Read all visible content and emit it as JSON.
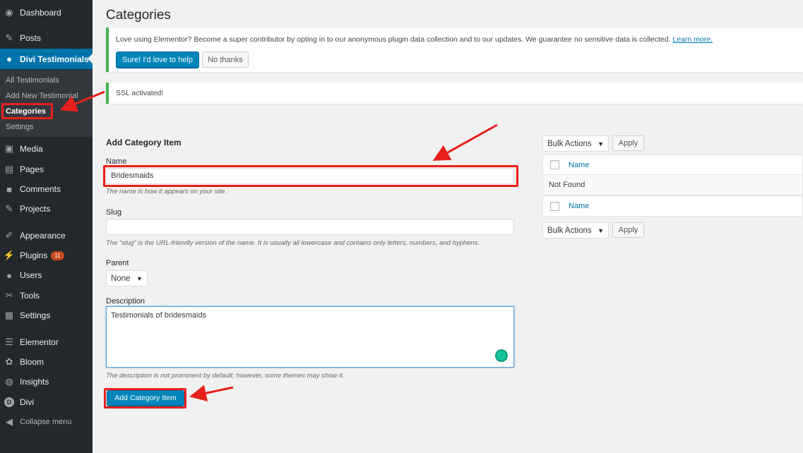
{
  "sidebar": {
    "items": [
      {
        "label": "Dashboard",
        "icon": "dashboard-icon"
      },
      {
        "label": "Posts",
        "icon": "pin-icon"
      },
      {
        "label": "Divi Testimonials",
        "icon": "user-icon"
      },
      {
        "label": "Media",
        "icon": "media-icon"
      },
      {
        "label": "Pages",
        "icon": "pages-icon"
      },
      {
        "label": "Comments",
        "icon": "comment-icon"
      },
      {
        "label": "Projects",
        "icon": "pin-icon"
      },
      {
        "label": "Appearance",
        "icon": "brush-icon"
      },
      {
        "label": "Plugins",
        "icon": "plug-icon",
        "badge": "11"
      },
      {
        "label": "Users",
        "icon": "user-icon"
      },
      {
        "label": "Tools",
        "icon": "wrench-icon"
      },
      {
        "label": "Settings",
        "icon": "settings-icon"
      },
      {
        "label": "Elementor",
        "icon": "elementor-icon"
      },
      {
        "label": "Bloom",
        "icon": "bloom-icon"
      },
      {
        "label": "Insights",
        "icon": "insights-icon"
      },
      {
        "label": "Divi",
        "icon": "divi-icon"
      },
      {
        "label": "Collapse menu",
        "icon": "collapse-icon"
      }
    ],
    "submenu": [
      "All Testimonials",
      "Add New Testimonial",
      "Categories",
      "Settings"
    ]
  },
  "page": {
    "title": "Categories"
  },
  "notices": {
    "elementor": {
      "text": "Love using Elementor? Become a super contributor by opting in to our anonymous plugin data collection and to our updates. We guarantee no sensitive data is collected.",
      "link": "Learn more.",
      "accept": "Sure! I'd love to help",
      "decline": "No thanks"
    },
    "ssl": "SSL activated!"
  },
  "form": {
    "heading": "Add Category Item",
    "name_label": "Name",
    "name_value": "Bridesmaids",
    "name_hint": "The name is how it appears on your site.",
    "slug_label": "Slug",
    "slug_value": "",
    "slug_hint": "The “slug” is the URL-friendly version of the name. It is usually all lowercase and contains only letters, numbers, and hyphens.",
    "parent_label": "Parent",
    "parent_value": "None",
    "description_label": "Description",
    "description_value": "Testimonials of bridesmaids",
    "description_hint": "The description is not prominent by default; however, some themes may show it.",
    "submit": "Add Category Item"
  },
  "table": {
    "bulk_actions": "Bulk Actions",
    "apply": "Apply",
    "column_name": "Name",
    "empty": "Not Found"
  },
  "colors": {
    "accent": "#0073aa",
    "annotation": "#e8201c",
    "notice_success": "#46b450",
    "sidebar_bg": "#23282d"
  }
}
